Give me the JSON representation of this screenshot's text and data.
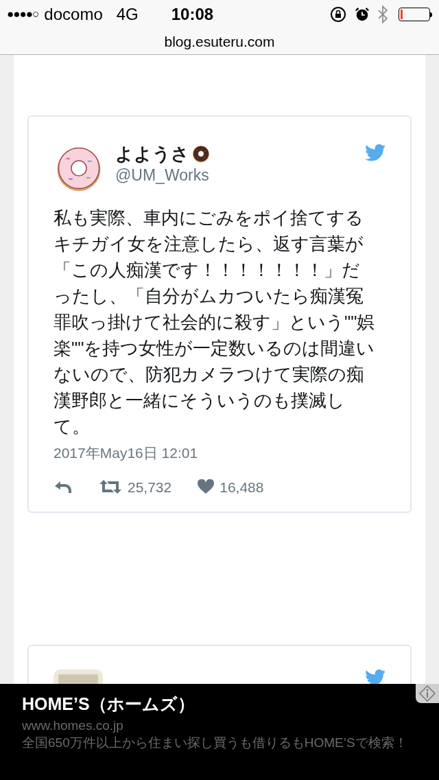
{
  "status_bar": {
    "signal_bars": "●●●●○",
    "carrier": "docomo",
    "network": "4G",
    "time": "10:08"
  },
  "url_bar": {
    "url": "blog.esuteru.com"
  },
  "tweets": [
    {
      "name": "よようさ",
      "handle": "@UM_Works",
      "text": "私も実際、車内にごみをポイ捨てするキチガイ女を注意したら、返す言葉が「この人痴漢です！！！！！！！」だったし、「自分がムカついたら痴漢冤罪吹っ掛けて社会的に殺す」という\"\"娯楽\"\"を持つ女性が一定数いるのは間違いないので、防犯カメラつけて実際の痴漢野郎と一緒にそういうのも撲滅して。",
      "date": "2017年May16日 12:01",
      "retweets": "25,732",
      "likes": "16,488"
    }
  ],
  "ad": {
    "title": "HOME’S（ホームズ）",
    "url": "www.homes.co.jp",
    "text": "全国650万件以上から住まい探し買うも借りるもHOME’Sで検索！"
  }
}
